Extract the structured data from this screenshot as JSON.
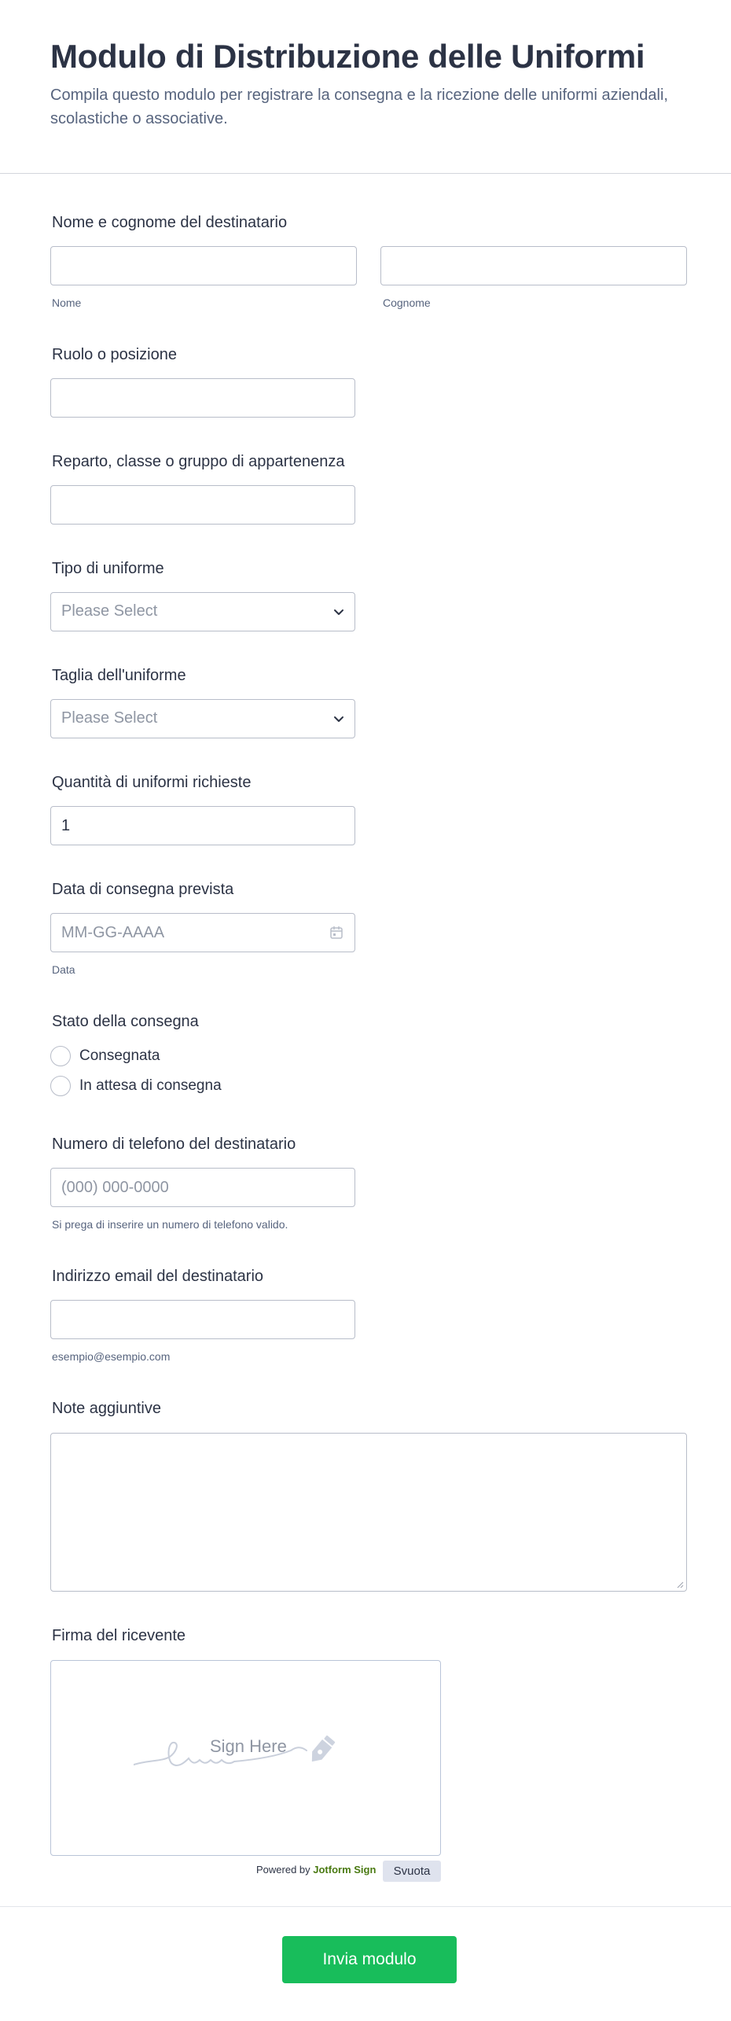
{
  "header": {
    "title": "Modulo di Distribuzione delle Uniformi",
    "subtitle": "Compila questo modulo per registrare la consegna e la ricezione delle uniformi aziendali, scolastiche o associative."
  },
  "fields": {
    "name": {
      "label": "Nome e cognome del destinatario",
      "first_sublabel": "Nome",
      "last_sublabel": "Cognome"
    },
    "role": {
      "label": "Ruolo o posizione"
    },
    "department": {
      "label": "Reparto, classe o gruppo di appartenenza"
    },
    "uniform_type": {
      "label": "Tipo di uniforme",
      "value": "Please Select"
    },
    "uniform_size": {
      "label": "Taglia dell'uniforme",
      "value": "Please Select"
    },
    "quantity": {
      "label": "Quantità di uniformi richieste",
      "value": "1"
    },
    "delivery_date": {
      "label": "Data di consegna prevista",
      "placeholder": "MM-GG-AAAA",
      "sublabel": "Data"
    },
    "delivery_status": {
      "label": "Stato della consegna",
      "options": [
        "Consegnata",
        "In attesa di consegna"
      ]
    },
    "phone": {
      "label": "Numero di telefono del destinatario",
      "placeholder": "(000) 000-0000",
      "sublabel": "Si prega di inserire un numero di telefono valido."
    },
    "email": {
      "label": "Indirizzo email del destinatario",
      "sublabel": "esempio@esempio.com"
    },
    "notes": {
      "label": "Note aggiuntive"
    },
    "signature": {
      "label": "Firma del ricevente",
      "placeholder": "Sign Here",
      "powered_prefix": "Powered by ",
      "powered_brand": "Jotform Sign",
      "clear_label": "Svuota"
    }
  },
  "submit_label": "Invia modulo",
  "colors": {
    "accent": "#18bd5b",
    "text": "#2c3345",
    "muted": "#57647e",
    "border": "#b8bdc9"
  }
}
